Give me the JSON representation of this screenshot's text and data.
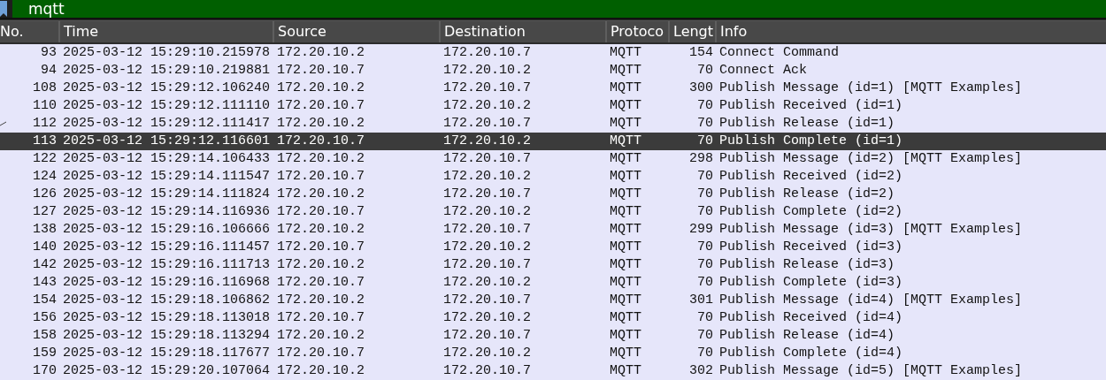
{
  "filter": {
    "value": "mqtt"
  },
  "table": {
    "columns": [
      "No.",
      "Time",
      "Source",
      "Destination",
      "Protoco",
      "Lengt",
      "Info"
    ],
    "rows": [
      {
        "cells": [
          "93",
          "2025-03-12 15:29:10.215978",
          "172.20.10.2",
          "172.20.10.7",
          "MQTT",
          "154",
          "Connect Command"
        ],
        "selected": false,
        "marked": false
      },
      {
        "cells": [
          "94",
          "2025-03-12 15:29:10.219881",
          "172.20.10.7",
          "172.20.10.2",
          "MQTT",
          "70",
          "Connect Ack"
        ],
        "selected": false,
        "marked": false
      },
      {
        "cells": [
          "108",
          "2025-03-12 15:29:12.106240",
          "172.20.10.2",
          "172.20.10.7",
          "MQTT",
          "300",
          "Publish Message (id=1) [MQTT Examples]"
        ],
        "selected": false,
        "marked": false
      },
      {
        "cells": [
          "110",
          "2025-03-12 15:29:12.111110",
          "172.20.10.7",
          "172.20.10.2",
          "MQTT",
          "70",
          "Publish Received (id=1)"
        ],
        "selected": false,
        "marked": false
      },
      {
        "cells": [
          "112",
          "2025-03-12 15:29:12.111417",
          "172.20.10.2",
          "172.20.10.7",
          "MQTT",
          "70",
          "Publish Release (id=1)"
        ],
        "selected": false,
        "marked": true
      },
      {
        "cells": [
          "113",
          "2025-03-12 15:29:12.116601",
          "172.20.10.7",
          "172.20.10.2",
          "MQTT",
          "70",
          "Publish Complete (id=1)"
        ],
        "selected": true,
        "marked": false
      },
      {
        "cells": [
          "122",
          "2025-03-12 15:29:14.106433",
          "172.20.10.2",
          "172.20.10.7",
          "MQTT",
          "298",
          "Publish Message (id=2) [MQTT Examples]"
        ],
        "selected": false,
        "marked": false
      },
      {
        "cells": [
          "124",
          "2025-03-12 15:29:14.111547",
          "172.20.10.7",
          "172.20.10.2",
          "MQTT",
          "70",
          "Publish Received (id=2)"
        ],
        "selected": false,
        "marked": false
      },
      {
        "cells": [
          "126",
          "2025-03-12 15:29:14.111824",
          "172.20.10.2",
          "172.20.10.7",
          "MQTT",
          "70",
          "Publish Release (id=2)"
        ],
        "selected": false,
        "marked": false
      },
      {
        "cells": [
          "127",
          "2025-03-12 15:29:14.116936",
          "172.20.10.7",
          "172.20.10.2",
          "MQTT",
          "70",
          "Publish Complete (id=2)"
        ],
        "selected": false,
        "marked": false
      },
      {
        "cells": [
          "138",
          "2025-03-12 15:29:16.106666",
          "172.20.10.2",
          "172.20.10.7",
          "MQTT",
          "299",
          "Publish Message (id=3) [MQTT Examples]"
        ],
        "selected": false,
        "marked": false
      },
      {
        "cells": [
          "140",
          "2025-03-12 15:29:16.111457",
          "172.20.10.7",
          "172.20.10.2",
          "MQTT",
          "70",
          "Publish Received (id=3)"
        ],
        "selected": false,
        "marked": false
      },
      {
        "cells": [
          "142",
          "2025-03-12 15:29:16.111713",
          "172.20.10.2",
          "172.20.10.7",
          "MQTT",
          "70",
          "Publish Release (id=3)"
        ],
        "selected": false,
        "marked": false
      },
      {
        "cells": [
          "143",
          "2025-03-12 15:29:16.116968",
          "172.20.10.7",
          "172.20.10.2",
          "MQTT",
          "70",
          "Publish Complete (id=3)"
        ],
        "selected": false,
        "marked": false
      },
      {
        "cells": [
          "154",
          "2025-03-12 15:29:18.106862",
          "172.20.10.2",
          "172.20.10.7",
          "MQTT",
          "301",
          "Publish Message (id=4) [MQTT Examples]"
        ],
        "selected": false,
        "marked": false
      },
      {
        "cells": [
          "156",
          "2025-03-12 15:29:18.113018",
          "172.20.10.7",
          "172.20.10.2",
          "MQTT",
          "70",
          "Publish Received (id=4)"
        ],
        "selected": false,
        "marked": false
      },
      {
        "cells": [
          "158",
          "2025-03-12 15:29:18.113294",
          "172.20.10.2",
          "172.20.10.7",
          "MQTT",
          "70",
          "Publish Release (id=4)"
        ],
        "selected": false,
        "marked": false
      },
      {
        "cells": [
          "159",
          "2025-03-12 15:29:18.117677",
          "172.20.10.7",
          "172.20.10.2",
          "MQTT",
          "70",
          "Publish Complete (id=4)"
        ],
        "selected": false,
        "marked": false
      },
      {
        "cells": [
          "170",
          "2025-03-12 15:29:20.107064",
          "172.20.10.2",
          "172.20.10.7",
          "MQTT",
          "302",
          "Publish Message (id=5) [MQTT Examples]"
        ],
        "selected": false,
        "marked": false
      }
    ]
  }
}
